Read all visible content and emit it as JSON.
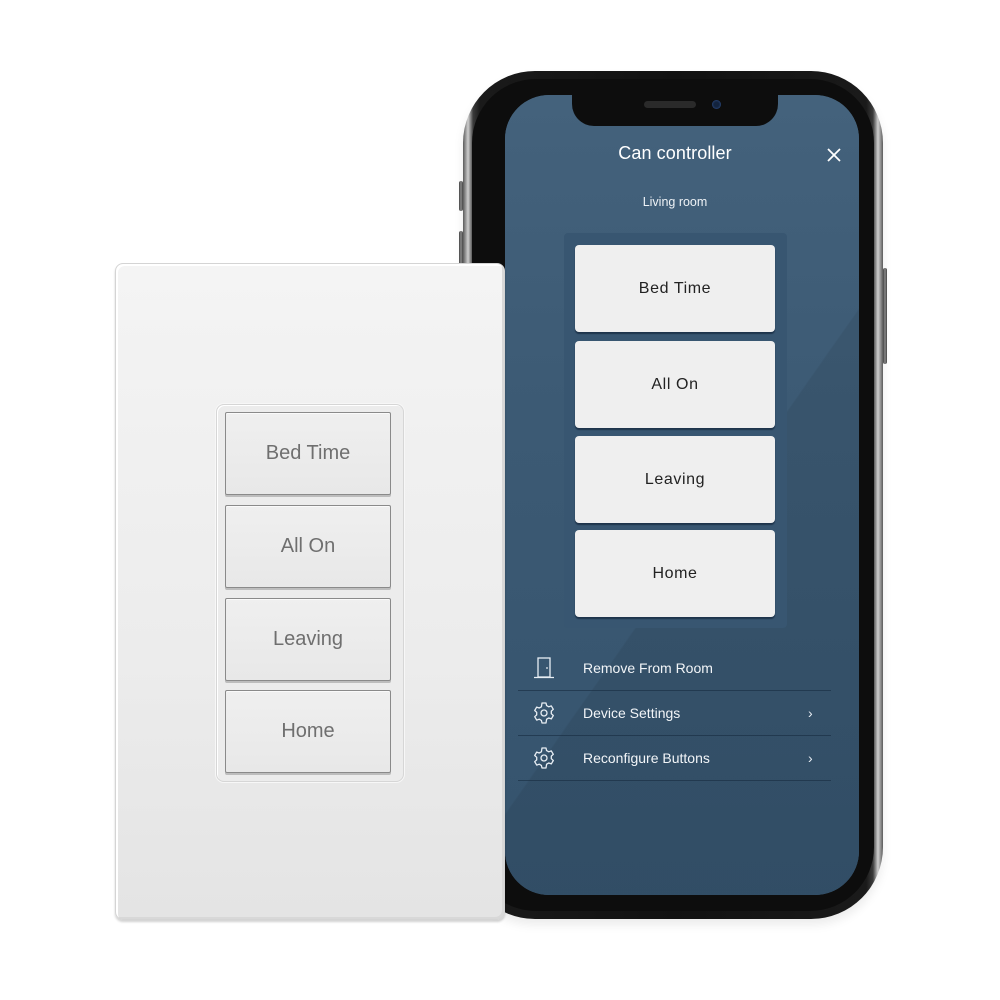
{
  "app": {
    "title": "Can controller",
    "room": "Living room",
    "close_icon": "close-icon"
  },
  "scene_buttons": [
    {
      "label": "Bed Time"
    },
    {
      "label": "All On"
    },
    {
      "label": "Leaving"
    },
    {
      "label": "Home"
    }
  ],
  "menu": [
    {
      "label": "Remove From Room",
      "icon": "door-icon",
      "chevron": ""
    },
    {
      "label": "Device Settings",
      "icon": "gear-icon",
      "chevron": "›"
    },
    {
      "label": "Reconfigure Buttons",
      "icon": "gear-icon",
      "chevron": "›"
    }
  ],
  "wall_keypad": {
    "keys": [
      {
        "label": "Bed Time"
      },
      {
        "label": "All On"
      },
      {
        "label": "Leaving"
      },
      {
        "label": "Home"
      }
    ]
  },
  "colors": {
    "screen_bg": "#3f5d77",
    "panel_bg": "#385671",
    "button_bg": "#efefef",
    "plate": "#ececec"
  }
}
